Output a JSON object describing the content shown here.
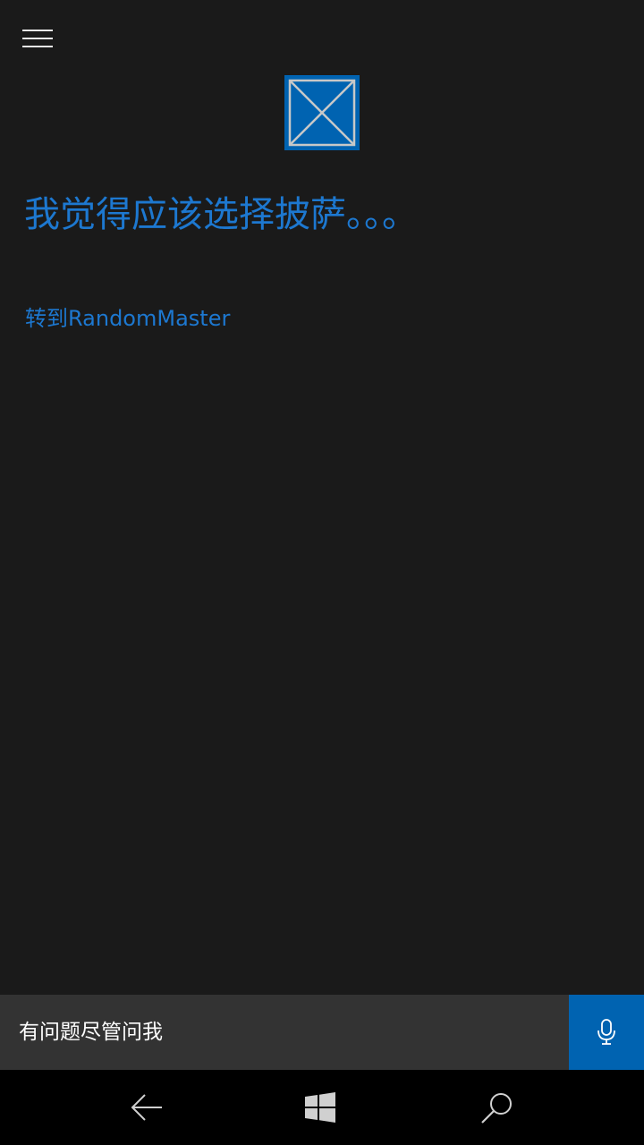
{
  "header": {
    "menu_icon": "hamburger-menu-icon"
  },
  "app_icon": {
    "icon": "broken-image-placeholder-icon",
    "accent": "#0063b1"
  },
  "main": {
    "answer_text": "我觉得应该选择披萨。。。",
    "goto_link": "转到RandomMaster"
  },
  "ask_bar": {
    "placeholder": "有问题尽管问我",
    "mic_icon": "microphone-icon"
  },
  "nav": {
    "back_icon": "back-arrow-icon",
    "start_icon": "windows-logo-icon",
    "search_icon": "search-icon"
  },
  "colors": {
    "background": "#1a1a1a",
    "accent_text": "#1d78d0",
    "accent": "#0063b1",
    "ask_bar": "#333333",
    "nav_bar": "#000000"
  }
}
